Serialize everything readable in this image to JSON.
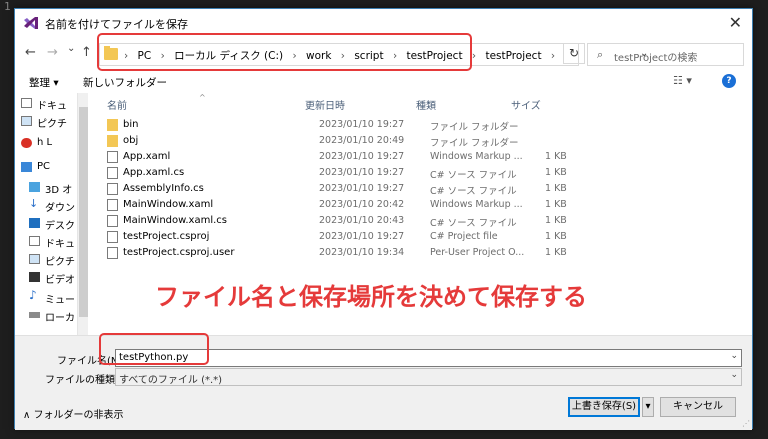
{
  "editor": {
    "line_number": "1"
  },
  "dialog": {
    "title": "名前を付けてファイルを保存",
    "close": "✕"
  },
  "nav": {
    "back": "←",
    "forward": "→",
    "up": "↑",
    "history": "⌄",
    "breadcrumb": [
      "PC",
      "ローカル ディスク (C:)",
      "work",
      "script",
      "testProject",
      "testProject"
    ],
    "separator": "›",
    "address_dropdown": "⌄",
    "refresh": "↻",
    "search_placeholder": "testProjectの検索"
  },
  "toolbar": {
    "organize": "整理 ▾",
    "new_folder": "新しいフォルダー",
    "view": "☷ ▾",
    "help": "?"
  },
  "sidebar": {
    "items": [
      {
        "label": "ドキュ",
        "icon": "document-icon"
      },
      {
        "label": "ピクチ",
        "icon": "picture-icon"
      },
      {
        "label": "h L",
        "icon": "blocked-icon"
      },
      {
        "label": "PC",
        "icon": "pc-icon"
      },
      {
        "label": "3D オ",
        "icon": "cube-icon"
      },
      {
        "label": "ダウン",
        "icon": "download-icon"
      },
      {
        "label": "デスク",
        "icon": "desktop-icon"
      },
      {
        "label": "ドキュ",
        "icon": "document-icon"
      },
      {
        "label": "ピクチ",
        "icon": "picture-icon"
      },
      {
        "label": "ビデオ",
        "icon": "video-icon"
      },
      {
        "label": "ミュー",
        "icon": "music-icon"
      },
      {
        "label": "ローカ",
        "icon": "drive-icon"
      }
    ]
  },
  "columns": {
    "name": "名前",
    "date": "更新日時",
    "type": "種類",
    "size": "サイズ"
  },
  "files": [
    {
      "name": "bin",
      "date": "2023/01/10 19:27",
      "type": "ファイル フォルダー",
      "size": "",
      "kind": "folder"
    },
    {
      "name": "obj",
      "date": "2023/01/10 20:49",
      "type": "ファイル フォルダー",
      "size": "",
      "kind": "folder"
    },
    {
      "name": "App.xaml",
      "date": "2023/01/10 19:27",
      "type": "Windows Markup ...",
      "size": "1 KB",
      "kind": "doc"
    },
    {
      "name": "App.xaml.cs",
      "date": "2023/01/10 19:27",
      "type": "C# ソース ファイル",
      "size": "1 KB",
      "kind": "cs"
    },
    {
      "name": "AssemblyInfo.cs",
      "date": "2023/01/10 19:27",
      "type": "C# ソース ファイル",
      "size": "1 KB",
      "kind": "cs"
    },
    {
      "name": "MainWindow.xaml",
      "date": "2023/01/10 20:42",
      "type": "Windows Markup ...",
      "size": "1 KB",
      "kind": "doc"
    },
    {
      "name": "MainWindow.xaml.cs",
      "date": "2023/01/10 20:43",
      "type": "C# ソース ファイル",
      "size": "1 KB",
      "kind": "cs"
    },
    {
      "name": "testProject.csproj",
      "date": "2023/01/10 19:27",
      "type": "C# Project file",
      "size": "1 KB",
      "kind": "doc"
    },
    {
      "name": "testProject.csproj.user",
      "date": "2023/01/10 19:34",
      "type": "Per-User Project O...",
      "size": "1 KB",
      "kind": "doc"
    }
  ],
  "annotation": "ファイル名と保存場所を決めて保存する",
  "form": {
    "filename_label": "ファイル名(N):",
    "filename_value": "testPython.py",
    "filetype_label": "ファイルの種類(T):",
    "filetype_value": "すべてのファイル (*.*)",
    "dropdown": "⌄"
  },
  "footer": {
    "hide_folders": "∧  フォルダーの非表示",
    "save": "上書き保存(S)",
    "save_split": "▾",
    "cancel": "キャンセル"
  },
  "colors": {
    "annotation": "#e53a3a",
    "accent": "#0078d7",
    "folder": "#f3c755"
  }
}
